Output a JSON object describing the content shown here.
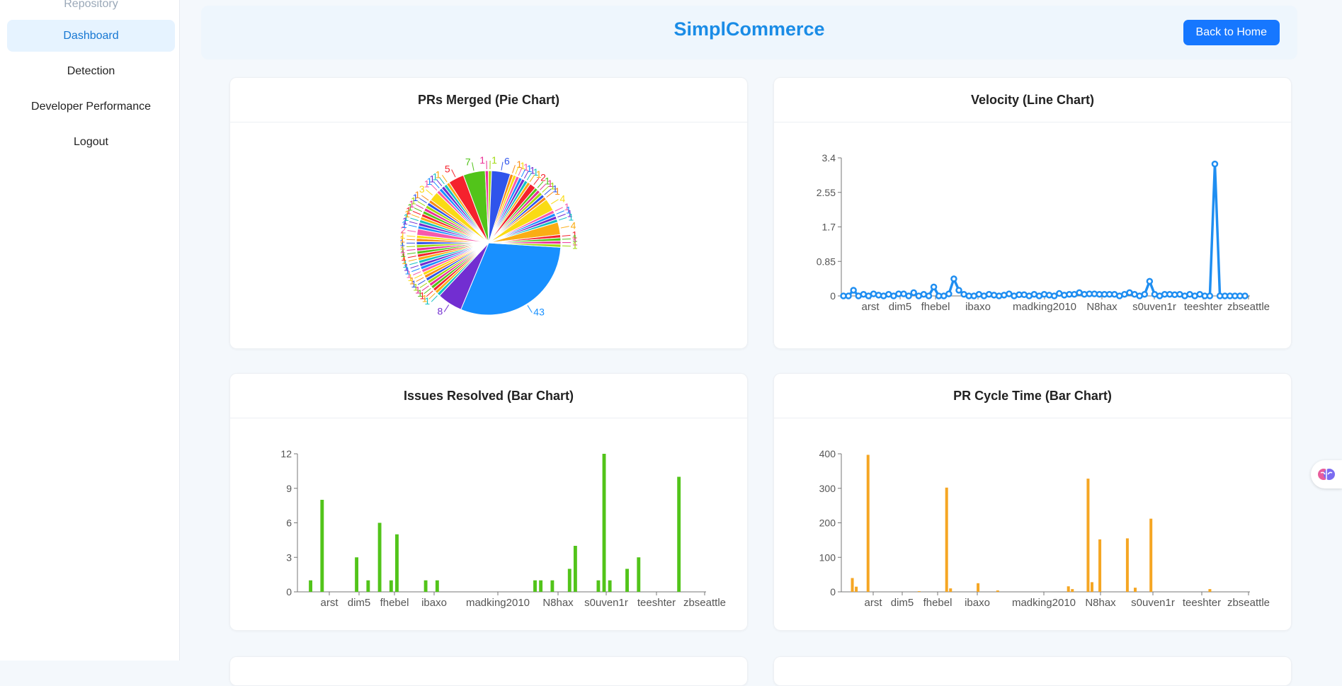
{
  "sidebar": {
    "items": [
      {
        "label": "Repository"
      },
      {
        "label": "Dashboard"
      },
      {
        "label": "Detection"
      },
      {
        "label": "Developer Performance"
      },
      {
        "label": "Logout"
      }
    ]
  },
  "header": {
    "title": "SimplCommerce",
    "back_label": "Back to Home"
  },
  "cards": [
    {
      "title": "PRs Merged (Pie Chart)"
    },
    {
      "title": "Velocity (Line Chart)"
    },
    {
      "title": "Issues Resolved (Bar Chart)"
    },
    {
      "title": "PR Cycle Time (Bar Chart)"
    }
  ],
  "colors": {
    "accent": "#1677ff",
    "title": "#1a8ce6",
    "line": "#1f8ef1",
    "green": "#52c41a",
    "orange": "#f5a623",
    "pie_palette": [
      "#1890ff",
      "#722ed1",
      "#13c2c2",
      "#faad14",
      "#f5222d",
      "#52c41a",
      "#eb2f96",
      "#a0d911",
      "#2f54eb",
      "#fa8c16",
      "#fadb14",
      "#f759ab"
    ]
  },
  "float_icon": "brain-icon",
  "chart_data": [
    {
      "type": "pie",
      "title": "PRs Merged (Pie Chart)",
      "values": [
        43,
        8,
        1,
        1,
        1,
        1,
        1,
        1,
        1,
        1,
        1,
        1,
        1,
        1,
        1,
        1,
        1,
        1,
        1,
        1,
        1,
        1,
        1,
        2,
        1,
        1,
        1,
        1,
        1,
        1,
        1,
        1,
        1,
        1,
        3,
        1,
        1,
        1,
        1,
        1,
        5,
        7,
        1,
        1,
        6,
        1,
        1,
        1,
        1,
        1,
        1,
        1,
        2,
        1,
        1,
        1,
        1,
        1,
        4,
        1,
        1,
        1,
        1,
        4,
        1,
        1,
        1,
        1
      ],
      "labels": [
        "43",
        "8",
        "1",
        "1",
        "1",
        "1",
        "1",
        "1",
        "1",
        "1",
        "1",
        "1",
        "1",
        "1",
        "1",
        "1",
        "1",
        "1",
        "1",
        "1",
        "1",
        "1",
        "1",
        "2",
        "1",
        "1",
        "1",
        "1",
        "1",
        "1",
        "1",
        "1",
        "1",
        "1",
        "3",
        "1",
        "1",
        "1",
        "1",
        "1",
        "5",
        "7",
        "1",
        "1",
        "6",
        "1",
        "1",
        "1",
        "1",
        "1",
        "1",
        "1",
        "2",
        "1",
        "1",
        "1",
        "1",
        "1",
        "4",
        "1",
        "1",
        "1",
        "1",
        "4",
        "1",
        "1",
        "1",
        "1"
      ]
    },
    {
      "type": "line",
      "title": "Velocity (Line Chart)",
      "x_ticks": [
        "arst",
        "dim5",
        "fhebel",
        "ibaxo",
        "madking2010",
        "N8hax",
        "s0uven1r",
        "teeshter",
        "zbseattle"
      ],
      "y_ticks": [
        "0",
        "0.85",
        "1.7",
        "2.55",
        "3.4"
      ],
      "ylim": [
        0,
        3.4
      ],
      "values": [
        0,
        0,
        0.14,
        0,
        0.04,
        0,
        0.05,
        0.02,
        0,
        0.04,
        0,
        0.05,
        0.05,
        0,
        0.08,
        0,
        0.04,
        0,
        0.22,
        0,
        0,
        0.05,
        0.42,
        0.14,
        0.04,
        0,
        0,
        0.04,
        0,
        0.04,
        0.02,
        0,
        0.02,
        0.05,
        0,
        0.03,
        0.03,
        0,
        0.04,
        0,
        0.04,
        0.02,
        0,
        0.06,
        0.02,
        0.04,
        0.04,
        0.08,
        0.04,
        0.05,
        0.05,
        0.04,
        0.04,
        0.04,
        0.04,
        0,
        0.04,
        0.08,
        0.04,
        0,
        0.04,
        0.36,
        0.04,
        0,
        0.04,
        0.04,
        0.03,
        0.04,
        0,
        0.04,
        0,
        0.04,
        0,
        0,
        3.25,
        0,
        0,
        0,
        0,
        0,
        0
      ]
    },
    {
      "type": "bar",
      "title": "Issues Resolved (Bar Chart)",
      "x_ticks": [
        "arst",
        "dim5",
        "fhebel",
        "ibaxo",
        "madking2010",
        "N8hax",
        "s0uven1r",
        "teeshter",
        "zbseattle"
      ],
      "y_ticks": [
        "0",
        "3",
        "6",
        "9",
        "12"
      ],
      "ylim": [
        0,
        12
      ],
      "values": [
        0,
        1,
        0,
        8,
        0,
        0,
        0,
        0,
        0,
        3,
        0,
        1,
        0,
        6,
        0,
        1,
        5,
        0,
        0,
        0,
        0,
        1,
        0,
        1,
        0,
        0,
        0,
        0,
        0,
        0,
        0,
        0,
        0,
        0,
        0,
        0,
        0,
        0,
        0,
        0,
        1,
        1,
        0,
        1,
        0,
        0,
        2,
        4,
        0,
        0,
        0,
        1,
        12,
        1,
        0,
        0,
        2,
        0,
        3,
        0,
        0,
        0,
        0,
        0,
        0,
        10,
        0,
        0,
        0,
        0,
        0
      ]
    },
    {
      "type": "bar",
      "title": "PR Cycle Time (Bar Chart)",
      "x_ticks": [
        "arst",
        "dim5",
        "fhebel",
        "ibaxo",
        "madking2010",
        "N8hax",
        "s0uven1r",
        "teeshter",
        "zbseattle"
      ],
      "y_ticks": [
        "0",
        "100",
        "200",
        "300",
        "400"
      ],
      "ylim": [
        0,
        400
      ],
      "values": [
        0,
        40,
        15,
        0,
        0,
        397,
        0,
        0,
        0,
        0,
        0,
        0,
        0,
        0,
        0,
        0,
        0,
        0,
        2,
        0,
        0,
        0,
        0,
        0,
        0,
        302,
        10,
        0,
        0,
        0,
        0,
        0,
        0,
        25,
        0,
        0,
        0,
        0,
        4,
        0,
        0,
        0,
        0,
        0,
        0,
        0,
        0,
        0,
        0,
        0,
        0,
        0,
        0,
        0,
        0,
        0,
        16,
        8,
        0,
        0,
        0,
        328,
        28,
        0,
        152,
        0,
        0,
        0,
        0,
        0,
        0,
        155,
        0,
        12,
        0,
        0,
        0,
        212,
        0,
        0,
        0,
        0,
        0,
        0,
        0,
        0,
        0,
        0,
        0,
        0,
        0,
        0,
        8,
        0,
        0,
        0,
        0,
        0,
        0,
        0,
        0,
        0,
        0,
        0
      ]
    }
  ]
}
